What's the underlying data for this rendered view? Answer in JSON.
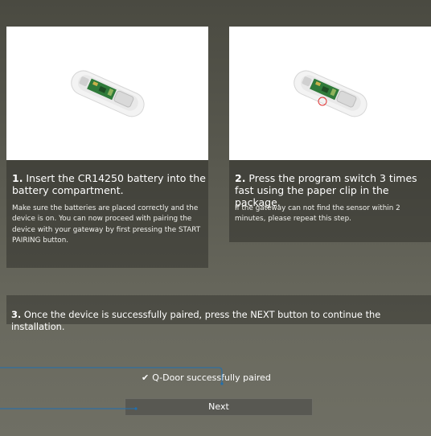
{
  "steps": [
    {
      "title_number": "1.",
      "title_text": " Insert the CR14250 battery into the battery compartment.",
      "body": "Make sure the batteries are placed correctly and the device is on. You can now proceed with pairing the device with your gateway by first pressing the START PAIRING button.",
      "image_icon": "device-battery-image"
    },
    {
      "title_number": "2.",
      "title_text": " Press the program switch 3 times fast using the paper clip in the package.",
      "body": "If the gateway can not find the sensor within 2 minutes, please repeat this step.",
      "image_icon": "device-program-switch-image"
    },
    {
      "title_number": "3.",
      "title_text": " Once the device is successfully paired, press the NEXT button to continue the installation."
    }
  ],
  "status": {
    "icon": "check-icon",
    "text": "Q-Door successfully paired"
  },
  "next_button": {
    "label": "Next"
  },
  "colors": {
    "callout_line": "#1f6fb0",
    "highlight_circle": "#e03030"
  }
}
